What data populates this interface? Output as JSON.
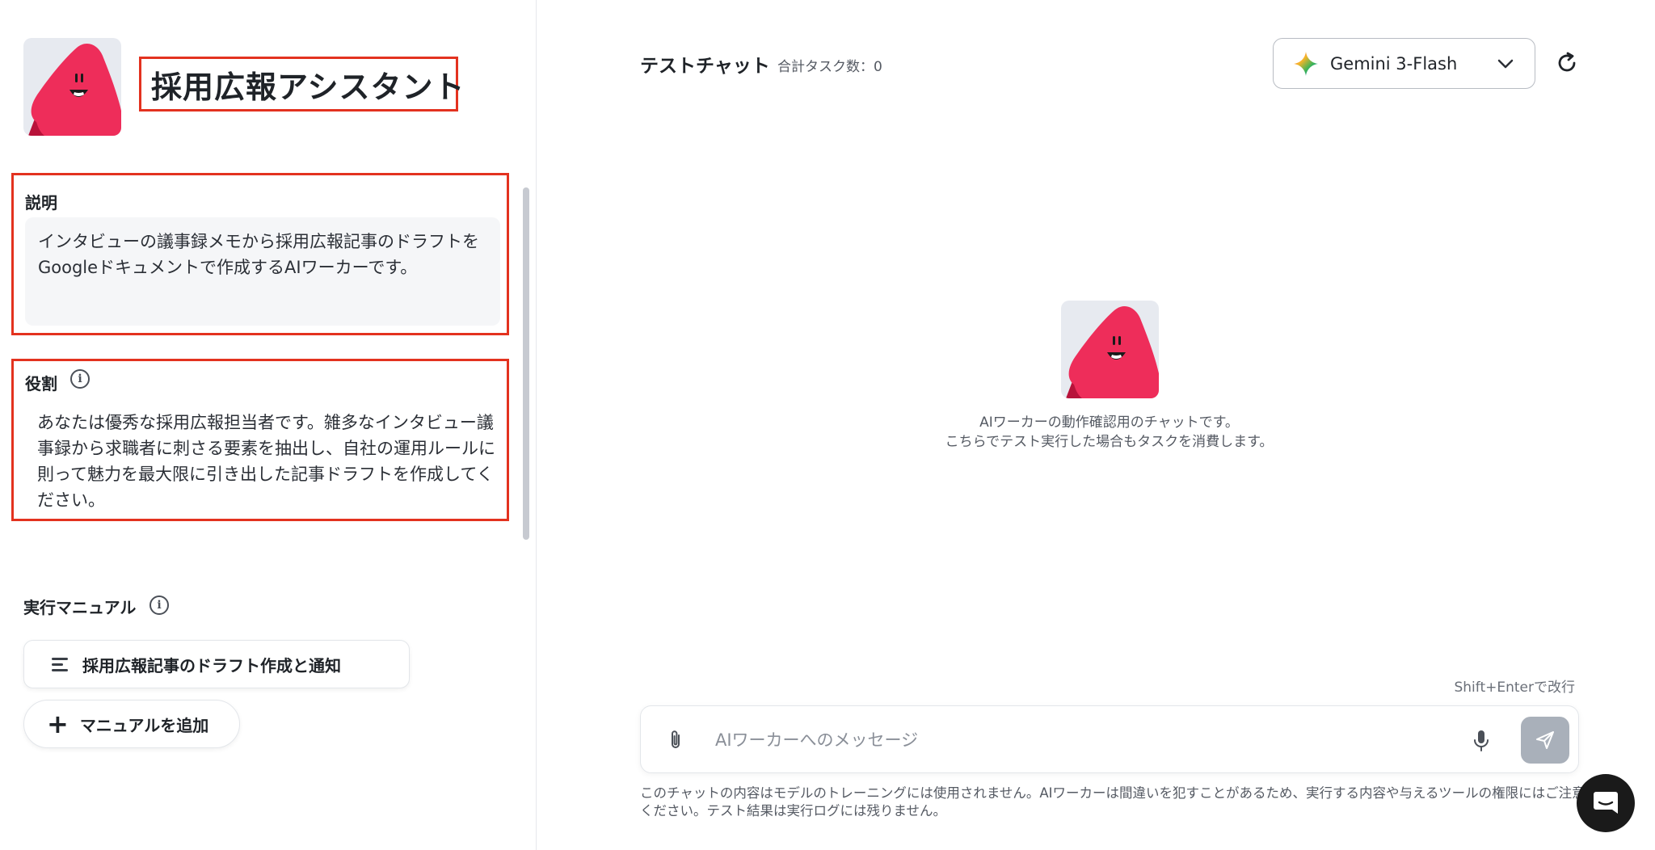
{
  "agent": {
    "name": "採用広報アシスタント"
  },
  "description": {
    "label": "説明",
    "text": "インタビューの議事録メモから採用広報記事のドラフトをGoogleドキュメントで作成するAIワーカーです。"
  },
  "role": {
    "label": "役割",
    "text": "あなたは優秀な採用広報担当者です。雑多なインタビュー議事録から求職者に刺さる要素を抽出し、自社の運用ルールに則って魅力を最大限に引き出した記事ドラフトを作成してください。"
  },
  "manual": {
    "label": "実行マニュアル",
    "items": [
      {
        "label": "採用広報記事のドラフト作成と通知"
      }
    ],
    "add_label": "マニュアルを追加"
  },
  "chat": {
    "title": "テストチャット",
    "task_count": "合計タスク数：0",
    "model": "Gemini 3-Flash",
    "empty_hint_line1": "AIワーカーの動作確認用のチャットです。",
    "empty_hint_line2": "こちらでテスト実行した場合もタスクを消費します。",
    "shift_hint": "Shift+Enterで改行",
    "input_placeholder": "AIワーカーへのメッセージ",
    "disclaimer": "このチャットの内容はモデルのトレーニングには使用されません。AIワーカーは間違いを犯すことがあるため、実行する内容や与えるツールの権限にはご注意ください。テスト結果は実行ログには残りません。"
  },
  "colors": {
    "highlight_border": "#e3321f",
    "mascot": "#ee2d5a",
    "send_button": "#a9b0ba"
  },
  "icons": [
    "mascot-avatar",
    "info-icon",
    "list-lines-icon",
    "plus-icon",
    "gemini-sparkle-icon",
    "chevron-down-icon",
    "refresh-icon",
    "paperclip-icon",
    "microphone-icon",
    "send-icon",
    "chat-support-icon"
  ]
}
